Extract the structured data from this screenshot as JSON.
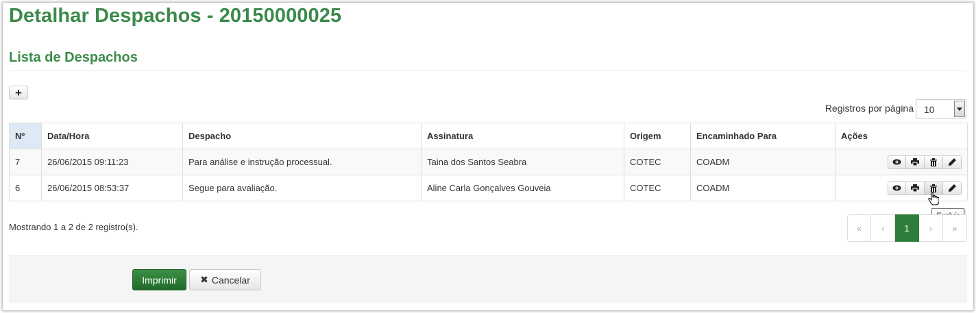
{
  "page": {
    "title": "Detalhar Despachos - 20150000025",
    "section_title": "Lista de Despachos"
  },
  "toolbar": {
    "add_label": "+",
    "per_page_label": "Registros por página",
    "per_page_value": "10"
  },
  "table": {
    "columns": [
      "Nº",
      "Data/Hora",
      "Despacho",
      "Assinatura",
      "Origem",
      "Encaminhado Para",
      "Ações"
    ],
    "rows": [
      {
        "numero": "7",
        "data_hora": "26/06/2015 09:11:23",
        "despacho": "Para análise e instrução processual.",
        "assinatura": "Taina dos Santos Seabra",
        "origem": "COTEC",
        "encaminhado": "COADM"
      },
      {
        "numero": "6",
        "data_hora": "26/06/2015 08:53:37",
        "despacho": "Segue para avaliação.",
        "assinatura": "Aline Carla Gonçalves Gouveia",
        "origem": "COTEC",
        "encaminhado": "COADM"
      }
    ],
    "row_actions": [
      "view-icon",
      "print-icon",
      "trash-icon",
      "pencil-icon"
    ]
  },
  "tooltip": {
    "text": "Excluir"
  },
  "footer": {
    "showing_text": "Mostrando 1 a 2 de 2 registro(s).",
    "pagination": {
      "first": "«",
      "prev": "‹",
      "current": "1",
      "next": "›",
      "last": "»"
    },
    "print_label": "Imprimir",
    "cancel_label": "Cancelar"
  },
  "colors": {
    "accent": "#3a8a4a",
    "primary_button": "#2e7d3a",
    "sorted_header": "#ddeaf5"
  }
}
